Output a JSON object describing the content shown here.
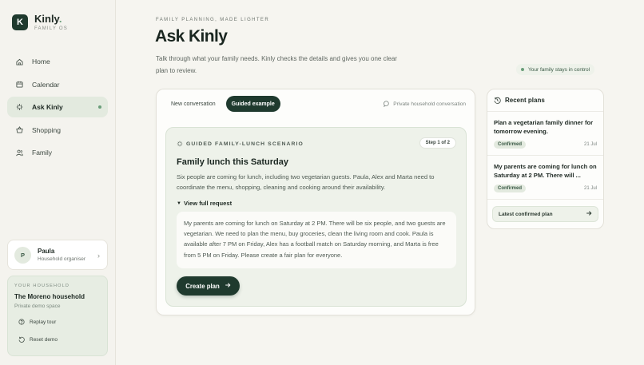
{
  "brand": {
    "logo_letter": "K",
    "name": "Kinly",
    "subtitle": "FAMILY OS"
  },
  "nav": {
    "items": [
      {
        "label": "Home",
        "icon": "home-icon"
      },
      {
        "label": "Calendar",
        "icon": "calendar-icon"
      },
      {
        "label": "Ask Kinly",
        "icon": "sparkle-icon",
        "active": true
      },
      {
        "label": "Shopping",
        "icon": "basket-icon"
      },
      {
        "label": "Family",
        "icon": "people-icon"
      }
    ]
  },
  "user": {
    "initial": "P",
    "name": "Paula",
    "role": "Household organiser"
  },
  "household": {
    "kicker": "YOUR HOUSEHOLD",
    "name": "The Moreno household",
    "sub": "Private demo space",
    "replay_label": "Replay tour",
    "reset_label": "Reset demo"
  },
  "header": {
    "kicker": "FAMILY PLANNING, MADE LIGHTER",
    "title": "Ask Kinly",
    "lead": "Talk through what your family needs. Kinly checks the details and gives you one clear plan to review.",
    "control_note": "Your family stays in control"
  },
  "panel": {
    "tabs": [
      {
        "label": "New conversation",
        "active": false
      },
      {
        "label": "Guided example",
        "active": true
      }
    ],
    "private_note": "Private household conversation",
    "scenario": {
      "kicker": "GUIDED FAMILY-LUNCH SCENARIO",
      "step": "Step 1 of 2",
      "title": "Family lunch this Saturday",
      "description": "Six people are coming for lunch, including two vegetarian guests. Paula, Alex and Marta need to coordinate the menu, shopping, cleaning and cooking around their availability.",
      "toggle_label": "View full request",
      "request": "My parents are coming for lunch on Saturday at 2 PM. There will be six people, and two guests are vegetarian. We need to plan the menu, buy groceries, clean the living room and cook. Paula is available after 7 PM on Friday, Alex has a football match on Saturday morning, and Marta is free from 5 PM on Friday. Please create a fair plan for everyone.",
      "create_label": "Create plan"
    }
  },
  "recent": {
    "title": "Recent plans",
    "plans": [
      {
        "title": "Plan a vegetarian family dinner for tomorrow evening.",
        "status": "Confirmed",
        "date": "21 Jul"
      },
      {
        "title": "My parents are coming for lunch on Saturday at 2 PM. There will ...",
        "status": "Confirmed",
        "date": "21 Jul"
      }
    ],
    "latest_label": "Latest confirmed plan"
  },
  "colors": {
    "accent": "#1f3a2e",
    "accent_soft": "#e3eadf",
    "dot": "#6b9e7a"
  }
}
